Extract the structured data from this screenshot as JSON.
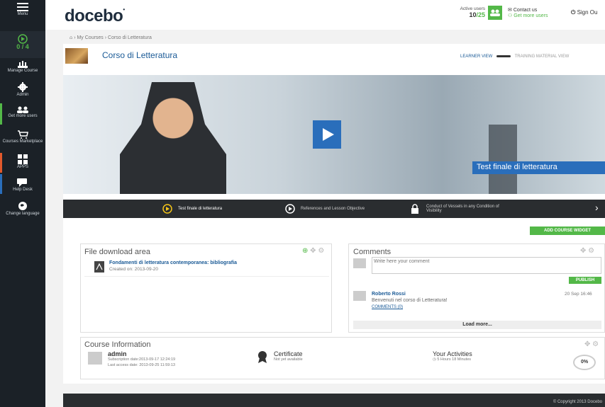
{
  "sidebar": {
    "menu_label": "Menu",
    "progress": "0 / 4",
    "manage_course": "Manage Course",
    "admin": "Admin",
    "get_more_users": "Get more users",
    "marketplace": "Courses Marketplace",
    "apps": "APPS",
    "help_desk": "Help Desk",
    "change_language": "Change language"
  },
  "header": {
    "logo": "docebo",
    "active_users_label": "Active users",
    "active_users_current": "10",
    "active_users_total": "/25",
    "contact_us": "Contact us",
    "get_more_users": "Get more users",
    "sign_out": "Sign Ou"
  },
  "breadcrumb": "› My Courses › Corso di Letteratura",
  "course": {
    "title": "Corso di Letteratura",
    "learner_view": "LEARNER VIEW",
    "training_view": "TRAINING MATERIAL VIEW",
    "video_caption": "Test finale di letteratura"
  },
  "player": {
    "items": [
      {
        "label": "Test finale di letteratura",
        "icon": "play-circle-icon"
      },
      {
        "label": "References and Lesson Objective",
        "icon": "play-circle-icon"
      },
      {
        "label": "Conduct of Vessels in any Condition of Visibility",
        "icon": "lock-icon"
      }
    ]
  },
  "add_widget": "ADD COURSE WIDGET",
  "files": {
    "title": "File download area",
    "file_name": "Fondamenti di letteratura contemporanea: bibliografia",
    "file_date": "Created on: 2013-09-20"
  },
  "comments": {
    "title": "Comments",
    "placeholder": "Write here your comment",
    "publish": "PUBLISH",
    "author": "Roberto Rossi",
    "date": "20 Sep 16:46",
    "text": "Benvenuti nel corso di Letteratura!",
    "comments_link": "COMMENTS (0)",
    "load_more": "Load more..."
  },
  "info": {
    "title": "Course Information",
    "user": "admin",
    "subscription": "Subscription date:2013-09-17 12:24:19",
    "last_access": "Last access date: 2013-09-25 11:59:13",
    "certificate": "Certificate",
    "certificate_status": "Not yet available",
    "activities": "Your Activities",
    "activities_time": "5 Hours 18 Minutes",
    "progress": "0%"
  },
  "footer": "© Copyright 2013 Docebo",
  "colors": {
    "green": "#53b848",
    "dark": "#1b2127",
    "video_blue": "#2a6ebb"
  }
}
